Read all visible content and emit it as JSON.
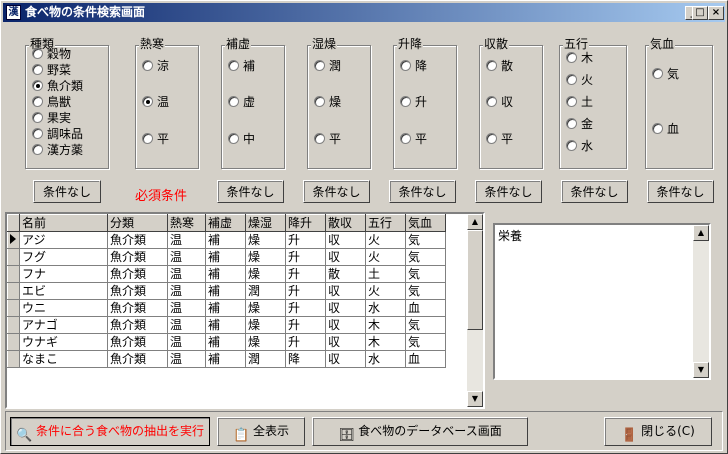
{
  "window": {
    "title": "食べ物の条件検索画面",
    "minimize": "_",
    "maximize": "□",
    "close": "×"
  },
  "groups": [
    {
      "label": "種類",
      "options": [
        "穀物",
        "野菜",
        "魚介類",
        "鳥獣",
        "果実",
        "調味品",
        "漢方薬"
      ],
      "selected": 2
    },
    {
      "label": "熱寒",
      "options": [
        "涼",
        "温",
        "平"
      ],
      "selected": 1
    },
    {
      "label": "補虚",
      "options": [
        "補",
        "虚",
        "中"
      ],
      "selected": -1
    },
    {
      "label": "湿燥",
      "options": [
        "潤",
        "燥",
        "平"
      ],
      "selected": -1
    },
    {
      "label": "升降",
      "options": [
        "降",
        "升",
        "平"
      ],
      "selected": -1
    },
    {
      "label": "収散",
      "options": [
        "散",
        "収",
        "平"
      ],
      "selected": -1
    },
    {
      "label": "五行",
      "options": [
        "木",
        "火",
        "土",
        "金",
        "水"
      ],
      "selected": -1
    },
    {
      "label": "気血",
      "options": [
        "気",
        "血"
      ],
      "selected": -1
    }
  ],
  "buttons": {
    "none": "条件なし",
    "required": "必須条件"
  },
  "table": {
    "columns": [
      "名前",
      "分類",
      "熱寒",
      "補虚",
      "燥湿",
      "降升",
      "散収",
      "五行",
      "気血"
    ],
    "rows": [
      [
        "アジ",
        "魚介類",
        "温",
        "補",
        "燥",
        "升",
        "収",
        "火",
        "気"
      ],
      [
        "フグ",
        "魚介類",
        "温",
        "補",
        "燥",
        "升",
        "収",
        "火",
        "気"
      ],
      [
        "フナ",
        "魚介類",
        "温",
        "補",
        "燥",
        "升",
        "散",
        "土",
        "気"
      ],
      [
        "エビ",
        "魚介類",
        "温",
        "補",
        "潤",
        "升",
        "収",
        "火",
        "気"
      ],
      [
        "ウニ",
        "魚介類",
        "温",
        "補",
        "燥",
        "升",
        "収",
        "水",
        "血"
      ],
      [
        "アナゴ",
        "魚介類",
        "温",
        "補",
        "燥",
        "升",
        "収",
        "木",
        "気"
      ],
      [
        "ウナギ",
        "魚介類",
        "温",
        "補",
        "燥",
        "升",
        "収",
        "木",
        "気"
      ],
      [
        "なまこ",
        "魚介類",
        "温",
        "補",
        "潤",
        "降",
        "収",
        "水",
        "血"
      ]
    ]
  },
  "memo": {
    "text": "栄養"
  },
  "bottom": {
    "execute": "条件に合う食べ物の抽出を実行",
    "show_all": "全表示",
    "database": "食べ物のデータベース画面",
    "close": "閉じる(C)"
  },
  "colors": {
    "title_start": "#0a246a",
    "title_end": "#a6caf0",
    "required": "#ff0000",
    "face": "#d4d0c8"
  },
  "icons": {
    "execute": "search-run-icon",
    "show_all": "list-icon",
    "database": "database-icon",
    "close": "door-exit-icon"
  }
}
